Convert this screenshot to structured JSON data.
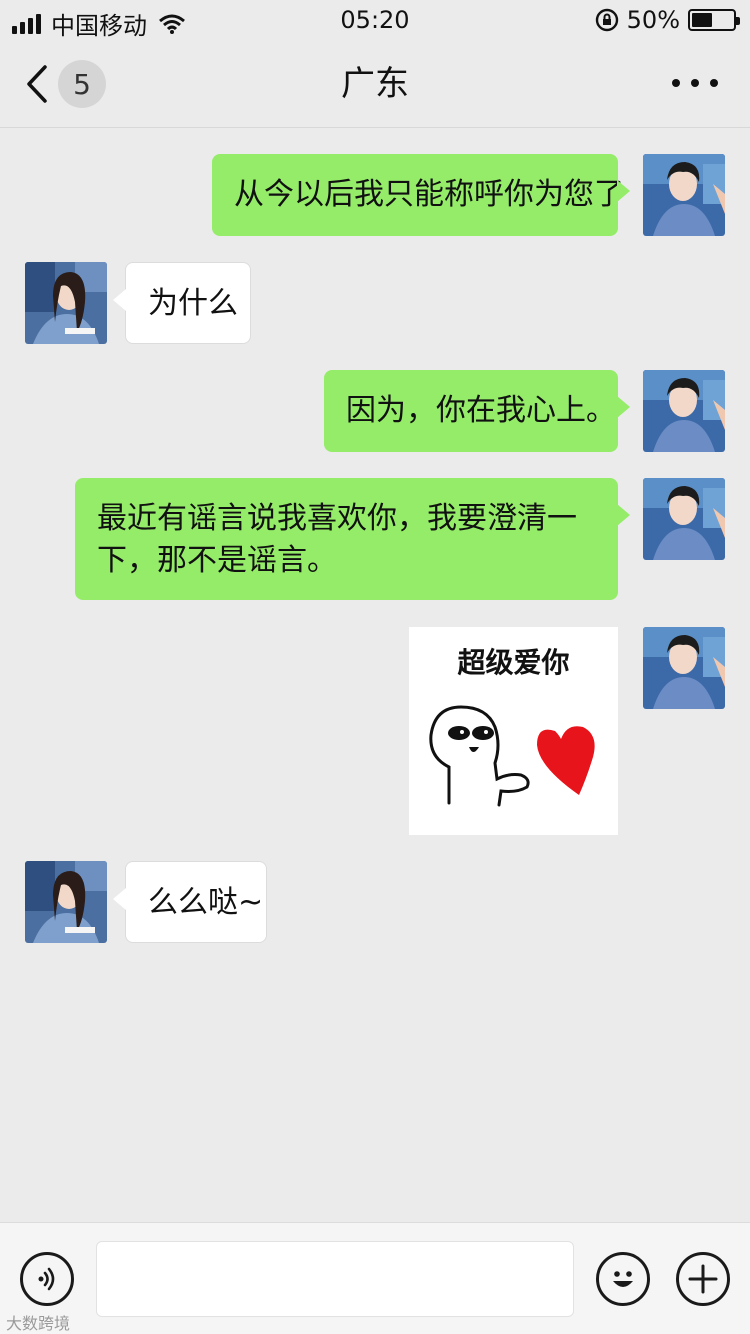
{
  "status_bar": {
    "carrier": "中国移动",
    "time": "05:20",
    "battery_text": "50%",
    "battery_level": 0.5
  },
  "nav": {
    "unread_count": "5",
    "title": "广东",
    "back_icon": "chevron-left-icon",
    "more_icon": "more-dots-icon"
  },
  "messages": [
    {
      "side": "me",
      "text": "从今以后我只能称呼你为您了"
    },
    {
      "side": "other",
      "text": "为什么"
    },
    {
      "side": "me",
      "text": "因为，你在我心上。"
    },
    {
      "side": "me",
      "text": "最近有谣言说我喜欢你，我要澄清一下，那不是谣言。"
    },
    {
      "side": "me",
      "type": "sticker",
      "text": "超级爱你"
    },
    {
      "side": "other",
      "text": "么么哒~"
    }
  ],
  "input_bar": {
    "voice_icon": "voice-icon",
    "emoji_icon": "emoji-icon",
    "add_icon": "plus-icon",
    "text_value": ""
  },
  "colors": {
    "background": "#ebebeb",
    "my_bubble": "#95ec69",
    "other_bubble": "#ffffff",
    "heart": "#e8141b"
  },
  "watermark": "大数跨境"
}
